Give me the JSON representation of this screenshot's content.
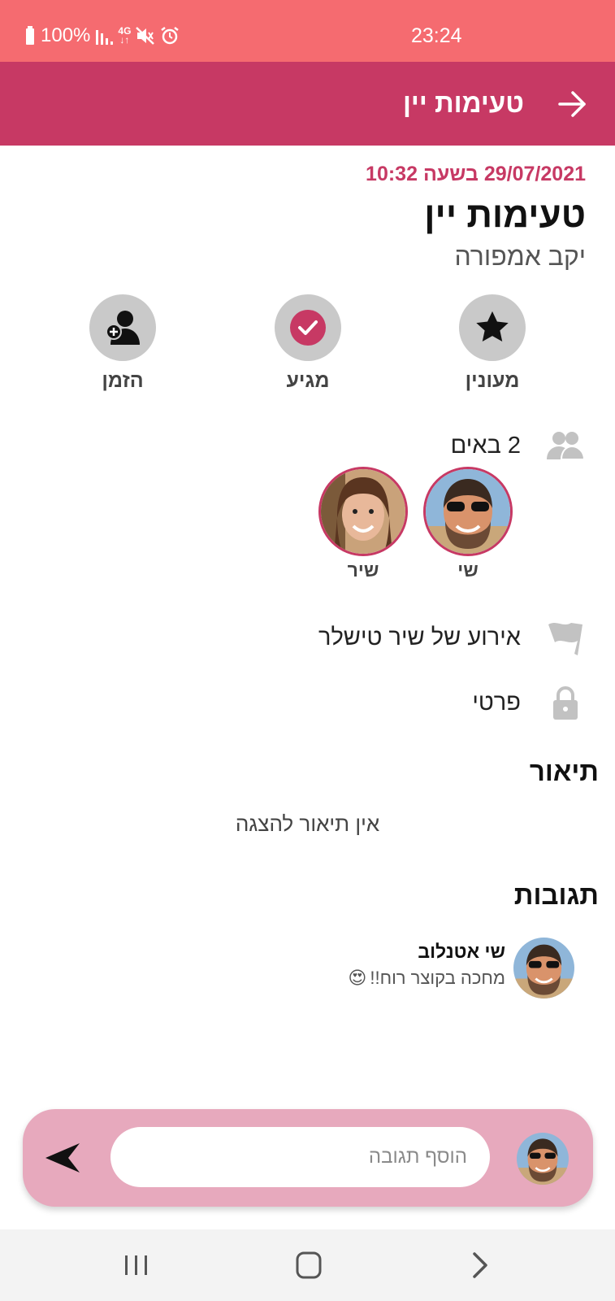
{
  "status_bar": {
    "battery": "100%",
    "network": "4G",
    "time": "23:24",
    "icons": [
      "battery-icon",
      "signal-icon",
      "network-4g-icon",
      "mute-icon",
      "alarm-icon"
    ]
  },
  "app_bar": {
    "title": "טעימות יין",
    "back_icon": "arrow-right-icon"
  },
  "event": {
    "date": "29/07/2021 בשעה 10:32",
    "title": "טעימות יין",
    "location": "יקב אמפורה"
  },
  "actions": [
    {
      "label": "מעונין",
      "icon": "star-icon"
    },
    {
      "label": "מגיע",
      "icon": "check-circle-icon"
    },
    {
      "label": "הזמן",
      "icon": "add-person-icon"
    }
  ],
  "attendees": {
    "count_text": "2 באים",
    "people": [
      {
        "name": "שי"
      },
      {
        "name": "שיר"
      }
    ]
  },
  "organizer": {
    "text": "אירוע של שיר טישלר",
    "icon": "flag-icon"
  },
  "privacy": {
    "text": "פרטי",
    "icon": "lock-icon"
  },
  "description": {
    "title": "תיאור",
    "empty_text": "אין תיאור להצגה"
  },
  "comments": {
    "title": "תגובות",
    "items": [
      {
        "author": "שי אטנלוב",
        "text": "מחכה בקוצר רוח!!",
        "emoji": "😍"
      }
    ]
  },
  "composer": {
    "placeholder": "הוסף תגובה",
    "send_icon": "send-icon"
  },
  "nav": {
    "icons": [
      "recents-icon",
      "home-icon",
      "back-icon"
    ]
  },
  "colors": {
    "status_bar": "#f56b70",
    "primary": "#c73964",
    "composer_bg": "#e7a9bd",
    "action_circle": "#c9c9c9"
  }
}
